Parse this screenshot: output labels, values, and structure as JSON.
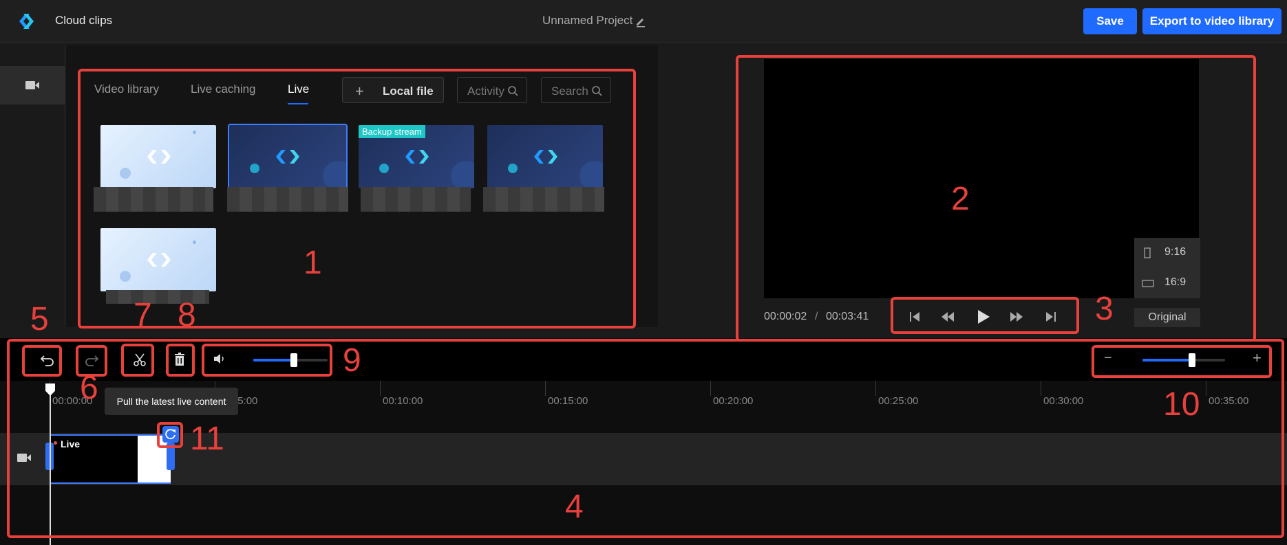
{
  "header": {
    "app_title": "Cloud clips",
    "project_name": "Unnamed Project",
    "save_label": "Save",
    "export_label": "Export to video library",
    "accent": "#1f6bff"
  },
  "media": {
    "tabs": [
      {
        "label": "Video library"
      },
      {
        "label": "Live caching"
      },
      {
        "label": "Live",
        "active": true
      }
    ],
    "local_file_label": "Local file",
    "activity_search_placeholder": "Activity",
    "keyword_search_placeholder": "Search",
    "backup_badge": "Backup stream",
    "badge_color": "#1fc6c6"
  },
  "preview": {
    "time_current": "00:00:02",
    "time_separator": "/",
    "time_total": "00:03:41",
    "ratio_portrait": "9:16",
    "ratio_landscape": "16:9",
    "original_label": "Original"
  },
  "timeline": {
    "volume_level": 0.55,
    "zoom_level": 0.6,
    "ruler_labels": [
      "00:00:00",
      "00:05:00",
      "00:10:00",
      "00:15:00",
      "00:20:00",
      "00:25:00",
      "00:30:00",
      "00:35:00"
    ],
    "tooltip": "Pull the latest live content",
    "clip_label": "Live"
  },
  "annotations": [
    "1",
    "2",
    "3",
    "4",
    "5",
    "6",
    "7",
    "8",
    "9",
    "10",
    "11"
  ],
  "annotation_color": "#e8413c"
}
